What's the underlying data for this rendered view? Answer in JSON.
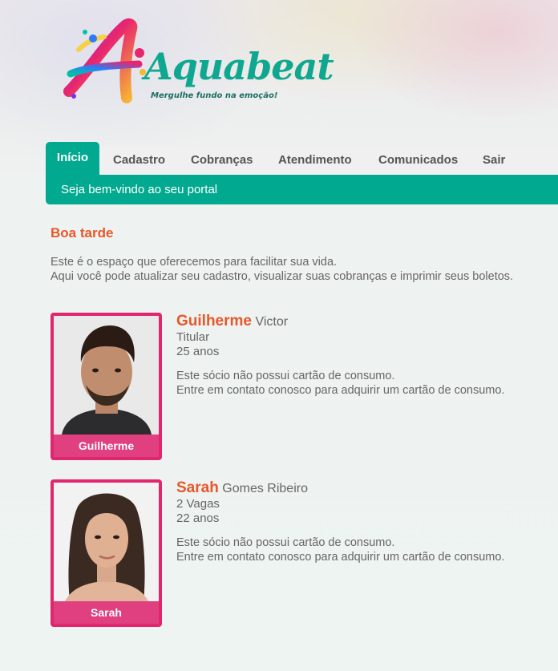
{
  "brand": {
    "name": "Aquabeat",
    "tagline": "Mergulhe fundo na emoção!"
  },
  "nav": {
    "tabs": [
      {
        "label": "Início",
        "active": true
      },
      {
        "label": "Cadastro",
        "active": false
      },
      {
        "label": "Cobranças",
        "active": false
      },
      {
        "label": "Atendimento",
        "active": false
      },
      {
        "label": "Comunicados",
        "active": false
      },
      {
        "label": "Sair",
        "active": false
      }
    ],
    "welcome": "Seja bem-vindo ao seu portal"
  },
  "main": {
    "greeting": "Boa tarde",
    "intro_line1": "Este é o espaço que oferecemos para facilitar sua vida.",
    "intro_line2": "Aqui você pode atualizar seu cadastro, visualizar suas cobranças e imprimir seus boletos."
  },
  "members": [
    {
      "first_name": "Guilherme",
      "last_name": "Victor",
      "role": "Titular",
      "age": "25 anos",
      "caption": "Guilherme",
      "note_line1": "Este sócio não possui cartão de consumo.",
      "note_line2": "Entre em contato conosco para adquirir um cartão de consumo."
    },
    {
      "first_name": "Sarah",
      "last_name": "Gomes Ribeiro",
      "role": "2 Vagas",
      "age": "22 anos",
      "caption": "Sarah",
      "note_line1": "Este sócio não possui cartão de consumo.",
      "note_line2": "Entre em contato conosco para adquirir um cartão de consumo."
    }
  ],
  "colors": {
    "accent": "#00a98f",
    "highlight": "#e8562a",
    "photo_frame": "#e0266e"
  }
}
